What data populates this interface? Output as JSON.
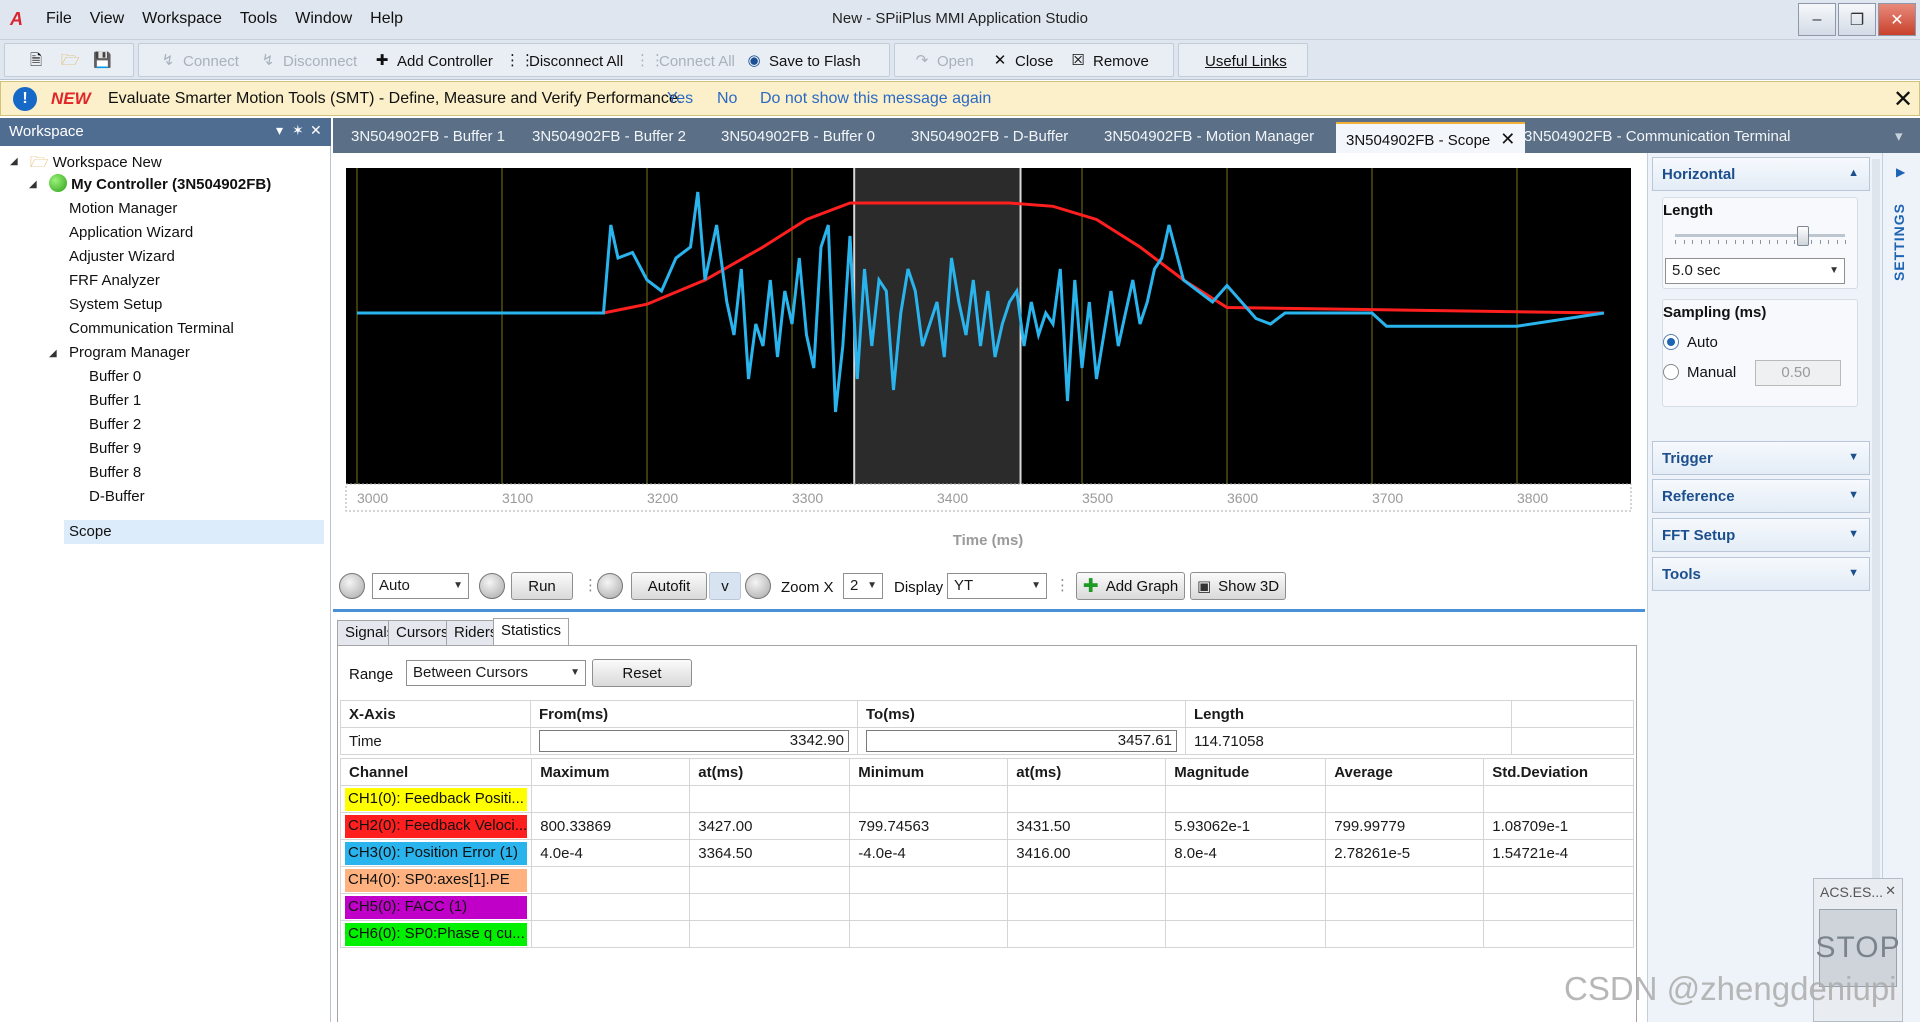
{
  "app": {
    "window_title": "New - SPiiPlus MMI Application Studio",
    "menu": [
      "File",
      "View",
      "Workspace",
      "Tools",
      "Window",
      "Help"
    ]
  },
  "toolbar": {
    "connect": "Connect",
    "disconnect": "Disconnect",
    "add_controller": "Add Controller",
    "disconnect_all": "Disconnect All",
    "connect_all": "Connect All",
    "save_to_flash": "Save to Flash",
    "open": "Open",
    "close": "Close",
    "remove": "Remove",
    "useful_links": "Useful Links"
  },
  "notification": {
    "badge": "NEW",
    "text": "Evaluate Smarter Motion Tools (SMT) - Define, Measure and Verify Performance.",
    "yes": "Yes",
    "no": "No",
    "dont_show": "Do not show this message again"
  },
  "workspace": {
    "title": "Workspace",
    "root": "Workspace New",
    "controller": "My Controller (3N504902FB)",
    "items": [
      "Motion Manager",
      "Application Wizard",
      "Adjuster Wizard",
      "FRF Analyzer",
      "System Setup",
      "Communication Terminal"
    ],
    "program_manager": "Program Manager",
    "buffers": [
      "Buffer 0",
      "Buffer 1",
      "Buffer 2",
      "Buffer 9",
      "Buffer 8",
      "D-Buffer"
    ],
    "scope": "Scope"
  },
  "doc_tabs": [
    "3N504902FB - Buffer 1",
    "3N504902FB - Buffer 2",
    "3N504902FB - Buffer 0",
    "3N504902FB - D-Buffer",
    "3N504902FB - Motion Manager",
    "3N504902FB - Scope",
    "3N504902FB - Communication Terminal"
  ],
  "chart_data": {
    "type": "line",
    "xlabel": "Time (ms)",
    "xlim": [
      3000,
      3860
    ],
    "ticks": [
      3000,
      3100,
      3200,
      3300,
      3400,
      3500,
      3600,
      3700,
      3800
    ],
    "cursor_region": [
      3342.9,
      3457.61
    ],
    "series": [
      {
        "color": "#ff1f1f",
        "x": [
          3000,
          3170,
          3200,
          3240,
          3280,
          3310,
          3340,
          3400,
          3450,
          3480,
          3510,
          3540,
          3570,
          3600,
          3860
        ],
        "y": [
          0.0,
          0.0,
          0.08,
          0.3,
          0.6,
          0.85,
          1.0,
          1.0,
          1.0,
          0.97,
          0.85,
          0.6,
          0.3,
          0.05,
          0.0
        ]
      },
      {
        "color": "#2ab4ee",
        "x": [
          3000,
          3170,
          3175,
          3180,
          3190,
          3200,
          3210,
          3220,
          3230,
          3235,
          3240,
          3248,
          3255,
          3260,
          3265,
          3270,
          3275,
          3280,
          3285,
          3290,
          3295,
          3300,
          3305,
          3310,
          3315,
          3320,
          3325,
          3330,
          3335,
          3340,
          3345,
          3350,
          3355,
          3360,
          3365,
          3370,
          3375,
          3380,
          3385,
          3390,
          3395,
          3400,
          3405,
          3410,
          3415,
          3420,
          3425,
          3430,
          3435,
          3440,
          3445,
          3450,
          3455,
          3460,
          3465,
          3470,
          3475,
          3480,
          3485,
          3490,
          3495,
          3500,
          3505,
          3510,
          3515,
          3520,
          3525,
          3530,
          3535,
          3540,
          3545,
          3550,
          3555,
          3560,
          3570,
          3580,
          3590,
          3600,
          3610,
          3620,
          3630,
          3640,
          3700,
          3710,
          3760,
          3770,
          3800,
          3860
        ],
        "y": [
          0.0,
          0.0,
          0.8,
          0.5,
          0.55,
          0.3,
          0.2,
          0.5,
          0.6,
          1.1,
          0.3,
          0.8,
          0.1,
          -0.2,
          0.4,
          -0.6,
          -0.1,
          -0.3,
          0.3,
          -0.4,
          0.2,
          -0.1,
          0.5,
          -0.2,
          -0.5,
          0.6,
          0.8,
          -0.9,
          -0.3,
          0.7,
          -0.6,
          0.4,
          -0.3,
          0.3,
          0.2,
          -0.7,
          0.0,
          0.4,
          0.2,
          -0.3,
          -0.1,
          0.1,
          -0.4,
          0.5,
          0.1,
          -0.2,
          0.3,
          -0.3,
          0.2,
          -0.4,
          -0.1,
          0.1,
          0.2,
          -0.3,
          0.1,
          -0.2,
          0.0,
          -0.1,
          0.4,
          -0.8,
          0.3,
          -0.5,
          0.1,
          -0.6,
          -0.2,
          0.2,
          -0.3,
          0.0,
          0.3,
          -0.1,
          0.1,
          0.4,
          0.5,
          0.8,
          0.3,
          0.2,
          0.1,
          0.25,
          0.1,
          -0.05,
          -0.1,
          0.0,
          0.0,
          -0.12,
          -0.12,
          -0.12,
          -0.12,
          0.0
        ]
      }
    ]
  },
  "controls": {
    "mode": "Auto",
    "run": "Run",
    "autofit": "Autofit",
    "v": "v",
    "zoom_label": "Zoom X",
    "zoom_value": "2",
    "display_label": "Display",
    "display_value": "YT",
    "add_graph": "Add Graph",
    "show_3d": "Show 3D"
  },
  "stats": {
    "tabs": [
      "Signals",
      "Cursors",
      "Riders",
      "Statistics"
    ],
    "range_label": "Range",
    "range_value": "Between Cursors",
    "reset": "Reset",
    "axis_headers": [
      "X-Axis",
      "From(ms)",
      "To(ms)",
      "Length"
    ],
    "axis_row": {
      "name": "Time",
      "from": "3342.90",
      "to": "3457.61",
      "length": "114.71058"
    },
    "headers": [
      "Channel",
      "Maximum",
      "at(ms)",
      "Minimum",
      "at(ms)",
      "Magnitude",
      "Average",
      "Std.Deviation"
    ],
    "rows": [
      {
        "channel": "CH1(0): Feedback Positi...",
        "color": "#ffff00",
        "max": "",
        "at_max": "",
        "min": "",
        "at_min": "",
        "mag": "",
        "avg": "",
        "std": ""
      },
      {
        "channel": "CH2(0): Feedback Veloci...",
        "color": "#ff1f1f",
        "max": "800.33869",
        "at_max": "3427.00",
        "min": "799.74563",
        "at_min": "3431.50",
        "mag": "5.93062e-1",
        "avg": "799.99779",
        "std": "1.08709e-1"
      },
      {
        "channel": "CH3(0): Position Error (1)",
        "color": "#2ab4ee",
        "max": "4.0e-4",
        "at_max": "3364.50",
        "min": "-4.0e-4",
        "at_min": "3416.00",
        "mag": "8.0e-4",
        "avg": "2.78261e-5",
        "std": "1.54721e-4"
      },
      {
        "channel": "CH4(0): SP0:axes[1].PE",
        "color": "#ffb27f",
        "max": "",
        "at_max": "",
        "min": "",
        "at_min": "",
        "mag": "",
        "avg": "",
        "std": ""
      },
      {
        "channel": "CH5(0): FACC (1)",
        "color": "#c000c8",
        "max": "",
        "at_max": "",
        "min": "",
        "at_min": "",
        "mag": "",
        "avg": "",
        "std": ""
      },
      {
        "channel": "CH6(0): SP0:Phase q cu...",
        "color": "#00f000",
        "max": "",
        "at_max": "",
        "min": "",
        "at_min": "",
        "mag": "",
        "avg": "",
        "std": ""
      }
    ]
  },
  "settings": {
    "horizontal": "Horizontal",
    "length_label": "Length",
    "length_value": "5.0 sec",
    "length_slider_fraction": 0.75,
    "sampling_label": "Sampling (ms)",
    "auto": "Auto",
    "manual": "Manual",
    "manual_value": "0.50",
    "trigger": "Trigger",
    "reference": "Reference",
    "fft_setup": "FFT Setup",
    "tools": "Tools",
    "side_label": "SETTINGS"
  },
  "acs_panel": {
    "title": "ACS.ES...",
    "stop": "STOP"
  },
  "watermark": "CSDN @zhengdeniupi"
}
